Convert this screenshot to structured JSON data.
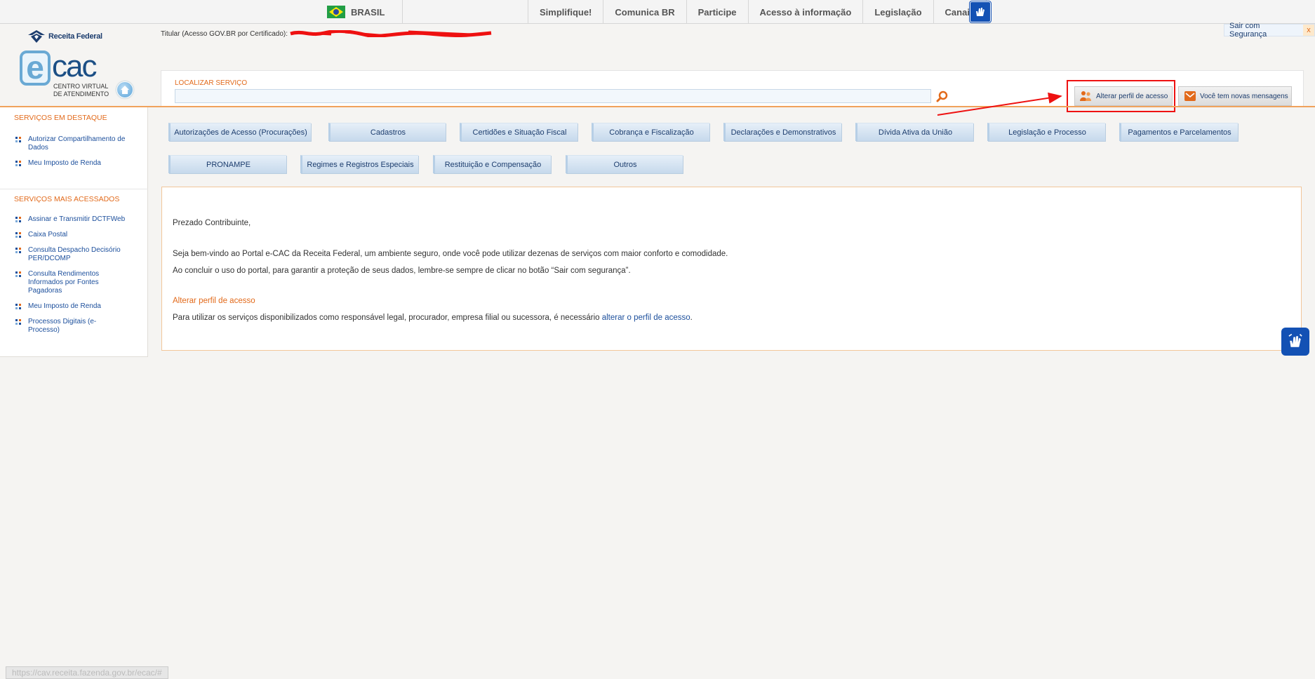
{
  "gov_bar": {
    "country": "BRASIL",
    "links": [
      "Simplifique!",
      "Comunica BR",
      "Participe",
      "Acesso à informação",
      "Legislação",
      "Canais"
    ],
    "accessibility_icon": "hand-sign-language-icon"
  },
  "header": {
    "rf_logo_text": "Receita Federal",
    "ecac_logo": {
      "e": "e",
      "cac": "cac",
      "subtitle": "CENTRO VIRTUAL DE ATENDIMENTO"
    },
    "titular_label": "Titular (Acesso GOV.BR por Certificado):",
    "sair_label": "Sair com Segurança",
    "sair_close": "x"
  },
  "search": {
    "label": "LOCALIZAR SERVIÇO",
    "value": "",
    "icon": "magnifier-icon"
  },
  "actions": {
    "alterar_perfil": "Alterar perfil de acesso",
    "mensagens": "Você tem novas mensagens"
  },
  "sidebar": {
    "destaque_title": "SERVIÇOS EM DESTAQUE",
    "destaque_items": [
      "Autorizar Compartilhamento de Dados",
      "Meu Imposto de Renda"
    ],
    "acessados_title": "SERVIÇOS MAIS ACESSADOS",
    "acessados_items": [
      "Assinar e Transmitir DCTFWeb",
      "Caixa Postal",
      "Consulta Despacho Decisório PER/DCOMP",
      "Consulta Rendimentos Informados por Fontes Pagadoras",
      "Meu Imposto de Renda",
      "Processos Digitais (e-Processo)"
    ]
  },
  "categories": {
    "row1": [
      "Autorizações de Acesso (Procurações)",
      "Cadastros",
      "Certidões e Situação Fiscal",
      "Cobrança e Fiscalização",
      "Declarações e Demonstrativos",
      "Dívida Ativa da União",
      "Legislação e Processo",
      "Pagamentos e Parcelamentos"
    ],
    "row2": [
      "PRONAMPE",
      "Regimes e Registros Especiais",
      "Restituição e Compensação",
      "Outros"
    ]
  },
  "welcome": {
    "greeting": "Prezado Contribuinte,",
    "para1": "Seja bem-vindo ao Portal e-CAC da Receita Federal, um ambiente seguro, onde você pode utilizar dezenas de serviços com maior conforto e comodidade.",
    "para2": "Ao concluir o uso do portal, para garantir a proteção de seus dados, lembre-se sempre de clicar no botão “Sair com segurança”.",
    "link_title": "Alterar perfil de acesso",
    "para3_prefix": "Para utilizar os serviços disponibilizados como responsável legal, procurador, empresa filial ou sucessora, é necessário ",
    "para3_link": "alterar o perfil de acesso",
    "para3_suffix": "."
  },
  "status_url": "https://cav.receita.fazenda.gov.br/ecac/#",
  "colors": {
    "accent": "#e26a1b",
    "link": "#1c4f9c",
    "annotation": "#ee1111",
    "vlibras": "#1351b4"
  }
}
